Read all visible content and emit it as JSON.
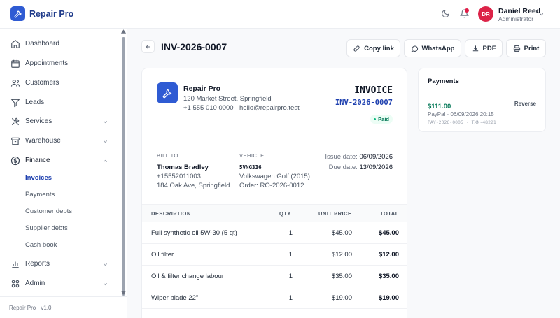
{
  "app": {
    "name": "Repair Pro",
    "version": "Repair Pro · v1.0"
  },
  "user": {
    "initials": "DR",
    "name": "Daniel Reed",
    "role": "Administrator"
  },
  "sidebar": {
    "items": [
      {
        "label": "Dashboard",
        "icon": "home-icon"
      },
      {
        "label": "Appointments",
        "icon": "calendar-icon"
      },
      {
        "label": "Customers",
        "icon": "users-icon"
      },
      {
        "label": "Leads",
        "icon": "filter-icon"
      },
      {
        "label": "Services",
        "icon": "tools-icon"
      },
      {
        "label": "Warehouse",
        "icon": "archive-icon"
      },
      {
        "label": "Finance",
        "icon": "dollar-icon"
      },
      {
        "label": "Reports",
        "icon": "bar-chart-icon"
      },
      {
        "label": "Admin",
        "icon": "grid-icon"
      }
    ],
    "finance_sub": [
      "Invoices",
      "Payments",
      "Customer debts",
      "Supplier debts",
      "Cash book"
    ],
    "active_sub": "Invoices"
  },
  "page": {
    "title": "INV-2026-0007",
    "actions": {
      "copy": "Copy link",
      "whatsapp": "WhatsApp",
      "pdf": "PDF",
      "print": "Print"
    }
  },
  "invoice": {
    "company": {
      "name": "Repair Pro",
      "address": "120 Market Street, Springfield",
      "contact": "+1 555 010 0000 · hello@repairpro.test"
    },
    "label": "INVOICE",
    "number": "INV-2026-0007",
    "status": "Paid",
    "bill_to": {
      "label": "BILL TO",
      "name": "Thomas Bradley",
      "phone": "+15552011003",
      "address": "184 Oak Ave, Springfield"
    },
    "vehicle": {
      "label": "VEHICLE",
      "plate": "5VNG336",
      "model": "Volkswagen Golf (2015)",
      "order": "Order: RO-2026-0012"
    },
    "issue_label": "Issue date:",
    "issue_date": "06/09/2026",
    "due_label": "Due date:",
    "due_date": "13/09/2026",
    "columns": {
      "desc": "DESCRIPTION",
      "qty": "QTY",
      "price": "UNIT PRICE",
      "total": "TOTAL"
    },
    "lines": [
      {
        "desc": "Full synthetic oil 5W-30 (5 qt)",
        "qty": "1",
        "price": "$45.00",
        "total": "$45.00"
      },
      {
        "desc": "Oil filter",
        "qty": "1",
        "price": "$12.00",
        "total": "$12.00"
      },
      {
        "desc": "Oil & filter change labour",
        "qty": "1",
        "price": "$35.00",
        "total": "$35.00"
      },
      {
        "desc": "Wiper blade 22\"",
        "qty": "1",
        "price": "$19.00",
        "total": "$19.00"
      }
    ]
  },
  "payments": {
    "title": "Payments",
    "amount": "$111.00",
    "reverse": "Reverse",
    "meta": "PayPal · 06/09/2026 20:15",
    "ref": "PAY-2026-0005 · TXN-48221"
  }
}
